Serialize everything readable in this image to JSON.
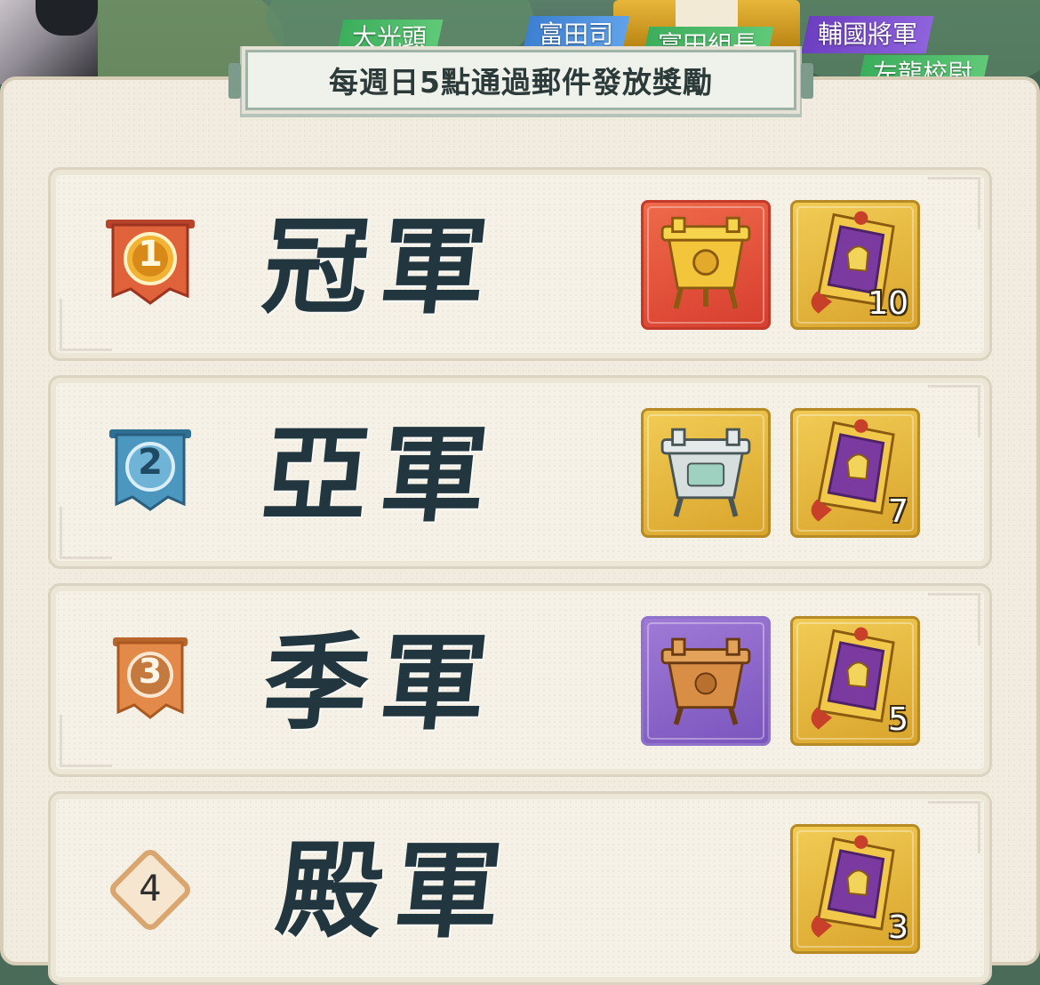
{
  "scene": {
    "name_tags": [
      {
        "text": "大光頭",
        "style": "green"
      },
      {
        "text": "富田司",
        "style": "blue"
      },
      {
        "text": "富田組長",
        "style": "green"
      },
      {
        "text": "輔國將軍",
        "style": "purple"
      },
      {
        "text": "左龍校尉",
        "style": "green"
      }
    ]
  },
  "banner": {
    "title": "每週日5點通過郵件發放獎勵"
  },
  "ranks": [
    {
      "rank": "1",
      "title": "冠軍",
      "badge_icon": "red-banner-medal-icon",
      "rewards": [
        {
          "icon": "gold-cauldron-icon",
          "background": "red",
          "count": ""
        },
        {
          "icon": "purple-token-card-icon",
          "background": "gold",
          "count": "10"
        }
      ]
    },
    {
      "rank": "2",
      "title": "亞軍",
      "badge_icon": "blue-banner-medal-icon",
      "rewards": [
        {
          "icon": "silver-cauldron-icon",
          "background": "gold",
          "count": ""
        },
        {
          "icon": "purple-token-card-icon",
          "background": "gold",
          "count": "7"
        }
      ]
    },
    {
      "rank": "3",
      "title": "季軍",
      "badge_icon": "orange-banner-medal-icon",
      "rewards": [
        {
          "icon": "bronze-cauldron-icon",
          "background": "purple",
          "count": ""
        },
        {
          "icon": "purple-token-card-icon",
          "background": "gold",
          "count": "5"
        }
      ]
    },
    {
      "rank": "4",
      "title": "殿軍",
      "badge_icon": "diamond-rank-icon",
      "rewards": [
        {
          "icon": "purple-token-card-icon",
          "background": "gold",
          "count": "3"
        }
      ]
    }
  ],
  "colors": {
    "panel_bg": "#f1ecdf",
    "title_ink": "#22363f",
    "rank1": "#e0623a",
    "rank2": "#4b97bf",
    "rank3": "#e3894a",
    "rank4": "#d9a66f"
  }
}
